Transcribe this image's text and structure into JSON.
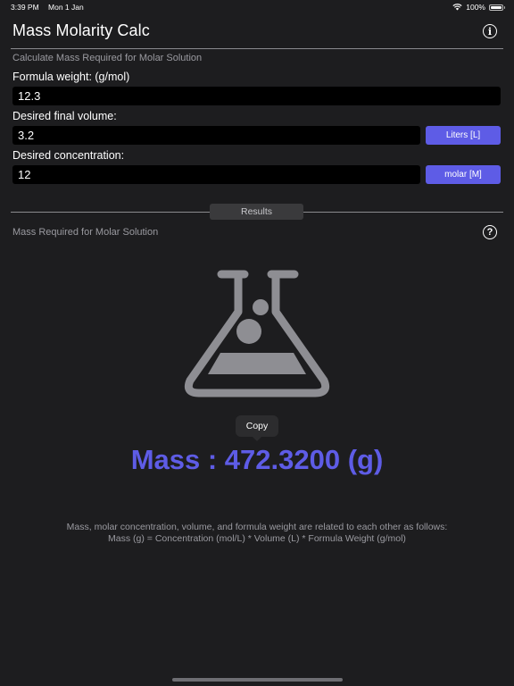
{
  "status_bar": {
    "time": "3:39 PM",
    "date": "Mon 1 Jan",
    "battery_pct": "100%",
    "wifi_icon": "wifi-icon",
    "battery_icon": "battery-icon"
  },
  "header": {
    "title": "Mass Molarity Calc",
    "info_icon": "info-icon"
  },
  "form": {
    "section_title": "Calculate Mass Required for Molar Solution",
    "formula_weight": {
      "label": "Formula weight:  (g/mol)",
      "value": "12.3"
    },
    "volume": {
      "label": "Desired final volume:",
      "value": "3.2",
      "unit": "Liters [L]"
    },
    "concentration": {
      "label": "Desired concentration:",
      "value": "12",
      "unit": "molar [M]"
    }
  },
  "results": {
    "tab_label": "Results",
    "section_title": "Mass Required for Molar Solution",
    "help_icon": "question-icon",
    "flask_icon": "flask-icon",
    "copy_label": "Copy",
    "mass_text": "Mass : 472.3200 (g)",
    "explanation_line1": "Mass, molar concentration, volume, and formula weight are related to each other as follows:",
    "explanation_line2": "Mass (g) = Concentration (mol/L) * Volume (L) * Formula Weight (g/mol)"
  },
  "colors": {
    "background": "#1d1d1f",
    "accent": "#5e5ce6",
    "icon_gray": "#8e8e93"
  }
}
